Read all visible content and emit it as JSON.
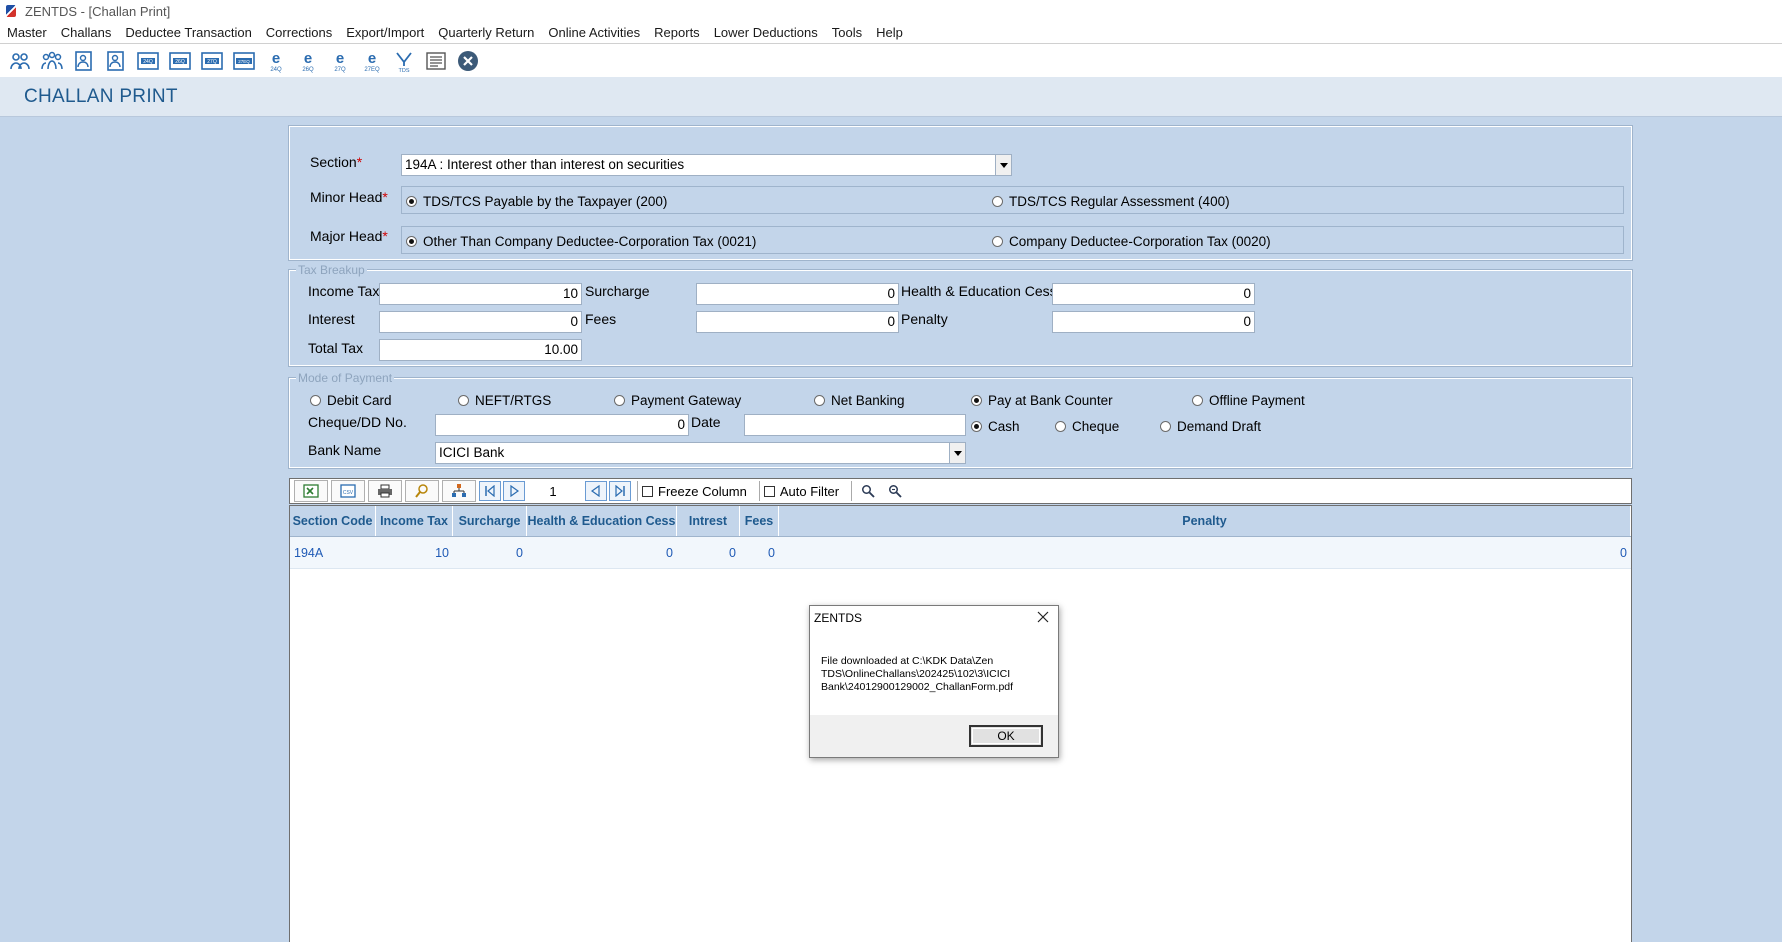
{
  "window": {
    "title": "ZENTDS - [Challan Print]"
  },
  "menu": [
    "Master",
    "Challans",
    "Deductee Transaction",
    "Corrections",
    "Export/Import",
    "Quarterly Return",
    "Online Activities",
    "Reports",
    "Lower Deductions",
    "Tools",
    "Help"
  ],
  "toolbar": {
    "icons": [
      "users-icon",
      "group-icon",
      "form-icon",
      "form-alt-icon",
      "form-24q-icon",
      "form-26q-icon",
      "form-27q-icon",
      "form-27eq-icon",
      "e-24q-icon",
      "e-26q-icon",
      "e-27q-icon",
      "e-27eq-icon",
      "tds-icon",
      "report-icon",
      "close-circle-icon"
    ],
    "badges": [
      "",
      "",
      "",
      "",
      "24Q",
      "26Q",
      "27Q",
      "27EQ",
      "24Q",
      "26Q",
      "27Q",
      "27EQ",
      "TDS",
      "",
      ""
    ]
  },
  "page": {
    "title": "CHALLAN PRINT"
  },
  "section": {
    "label": "Section",
    "value": "194A : Interest other than interest on securities"
  },
  "minor_head": {
    "label": "Minor Head",
    "options": [
      "TDS/TCS Payable by the Taxpayer (200)",
      "TDS/TCS Regular Assessment (400)"
    ],
    "selected": 0
  },
  "major_head": {
    "label": "Major Head",
    "options": [
      "Other Than Company Deductee-Corporation Tax (0021)",
      "Company Deductee-Corporation Tax (0020)"
    ],
    "selected": 0
  },
  "tax_breakup": {
    "legend": "Tax Breakup",
    "income_tax_label": "Income Tax",
    "income_tax": "10",
    "surcharge_label": "Surcharge",
    "surcharge": "0",
    "cess_label": "Health & Education Cess",
    "cess": "0",
    "interest_label": "Interest",
    "interest": "0",
    "fees_label": "Fees",
    "fees": "0",
    "penalty_label": "Penalty",
    "penalty": "0",
    "total_label": "Total Tax",
    "total": "10.00"
  },
  "payment": {
    "legend": "Mode of Payment",
    "modes": [
      "Debit Card",
      "NEFT/RTGS",
      "Payment Gateway",
      "Net Banking",
      "Pay at Bank Counter",
      "Offline Payment"
    ],
    "selected_mode": 4,
    "cheque_label": "Cheque/DD No.",
    "cheque_value": "0",
    "date_label": "Date",
    "date_value": "",
    "instruments": [
      "Cash",
      "Cheque",
      "Demand Draft"
    ],
    "selected_instrument": 0,
    "bank_label": "Bank Name",
    "bank_value": "ICICI Bank"
  },
  "grid_toolbar": {
    "page": "1",
    "freeze_label": "Freeze Column",
    "autofilter_label": "Auto Filter"
  },
  "grid": {
    "columns": [
      "Section Code",
      "Income Tax",
      "Surcharge",
      "Health & Education Cess",
      "Intrest",
      "Fees",
      "Penalty"
    ],
    "rows": [
      [
        "194A",
        "10",
        "0",
        "0",
        "0",
        "0",
        "0"
      ]
    ]
  },
  "dialog": {
    "title": "ZENTDS",
    "message": "File downloaded at C:\\KDK Data\\Zen TDS\\OnlineChallans\\202425\\102\\3\\ICICI Bank\\24012900129002_ChallanForm.pdf",
    "ok_label": "OK"
  },
  "colors": {
    "accent": "#1f5a8e",
    "background": "#c3d5ea",
    "required": "#d00000"
  }
}
